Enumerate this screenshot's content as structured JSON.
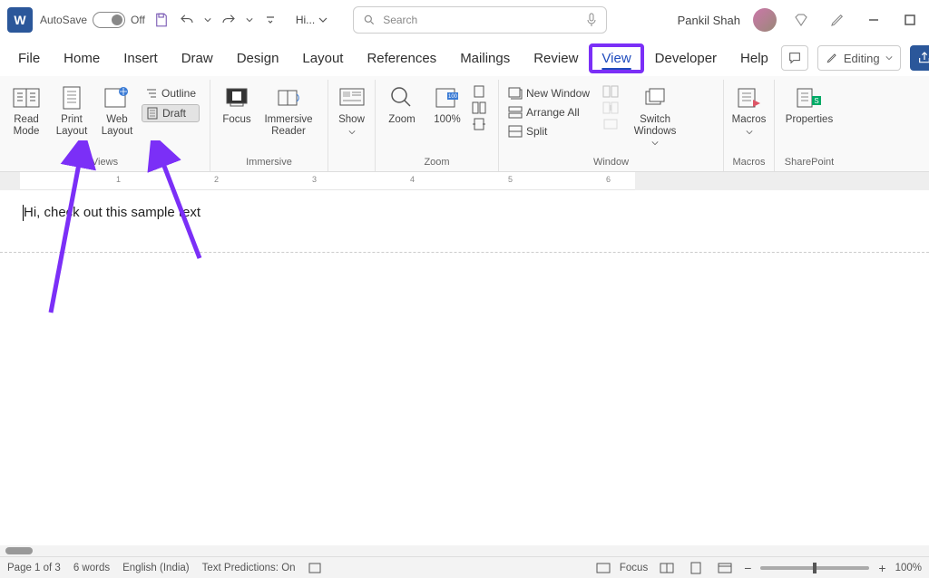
{
  "titlebar": {
    "app_letter": "W",
    "autosave_label": "AutoSave",
    "autosave_state": "Off",
    "doc_title": "Hi...",
    "search_placeholder": "Search",
    "user_name": "Pankil Shah"
  },
  "tabs": [
    "File",
    "Home",
    "Insert",
    "Draw",
    "Design",
    "Layout",
    "References",
    "Mailings",
    "Review",
    "View",
    "Developer",
    "Help"
  ],
  "active_tab": "View",
  "comments_label": "",
  "editing_label": "Editing",
  "ribbon": {
    "views": {
      "read_mode": "Read Mode",
      "print_layout": "Print Layout",
      "web_layout": "Web Layout",
      "outline": "Outline",
      "draft": "Draft",
      "group": "Views"
    },
    "immersive": {
      "focus": "Focus",
      "immersive_reader": "Immersive Reader",
      "group": "Immersive"
    },
    "show": {
      "label": "Show"
    },
    "zoom": {
      "zoom": "Zoom",
      "hundred": "100%",
      "group": "Zoom"
    },
    "window": {
      "new_window": "New Window",
      "arrange_all": "Arrange All",
      "split": "Split",
      "switch_windows": "Switch Windows",
      "group": "Window"
    },
    "macros": {
      "label": "Macros",
      "group": "Macros"
    },
    "sharepoint": {
      "label": "Properties",
      "group": "SharePoint"
    }
  },
  "ruler": {
    "marks": [
      1,
      2,
      3,
      4,
      5,
      6
    ]
  },
  "document": {
    "text": "Hi, check out this sample text"
  },
  "status": {
    "page": "Page 1 of 3",
    "words": "6 words",
    "language": "English (India)",
    "predictions": "Text Predictions: On",
    "focus": "Focus",
    "zoom": "100%"
  }
}
